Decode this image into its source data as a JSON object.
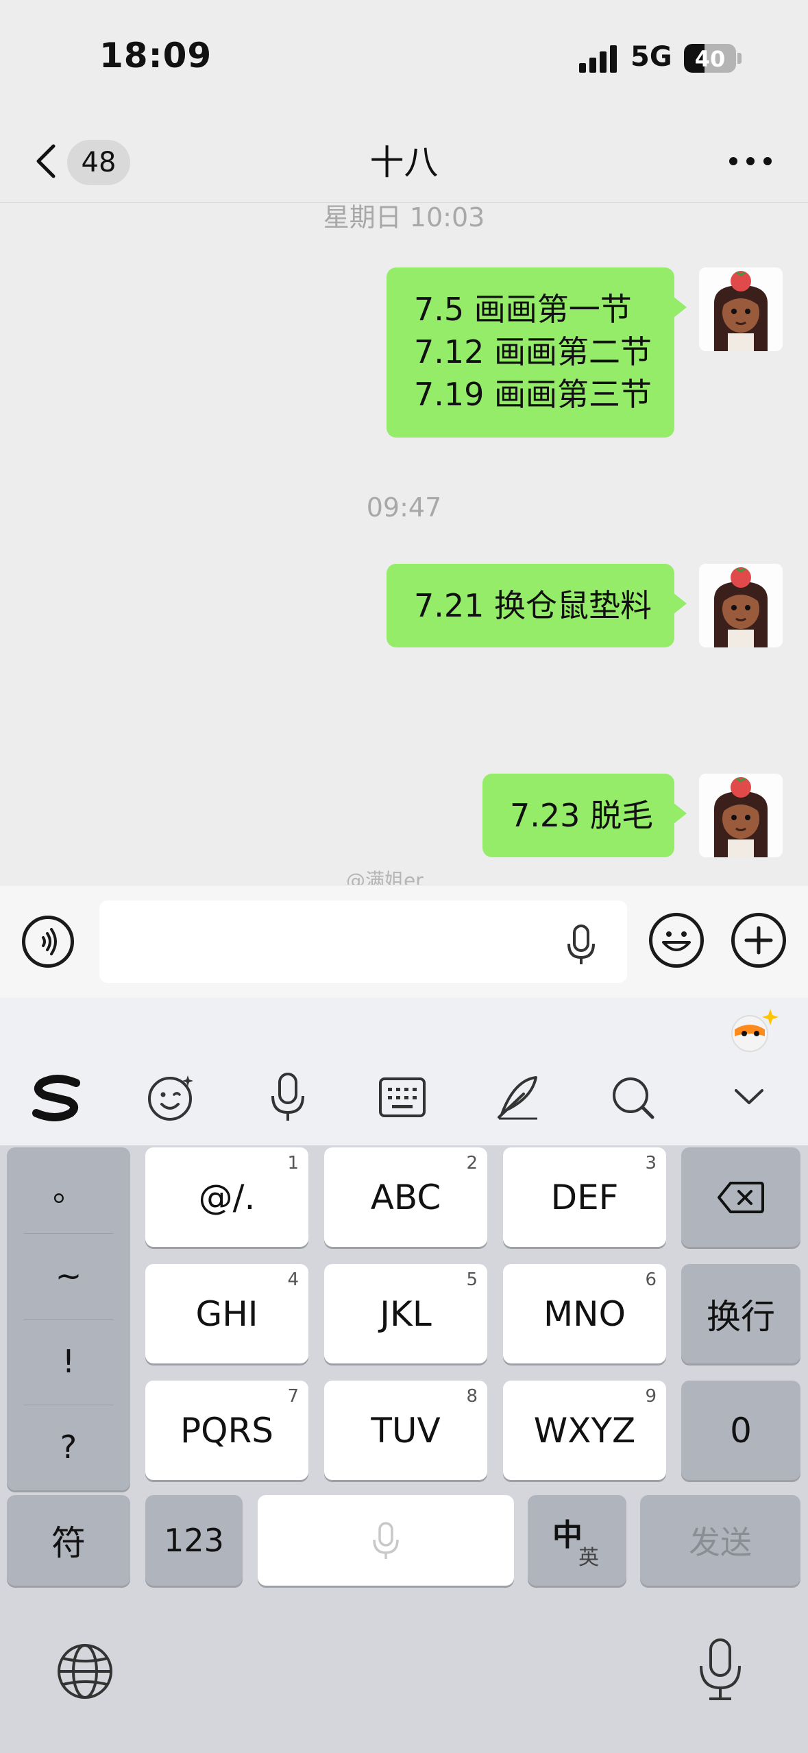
{
  "status": {
    "time": "18:09",
    "network": "5G",
    "battery": "40",
    "battery_level": 0.4
  },
  "nav": {
    "unread_count": "48",
    "title": "十八"
  },
  "chat": {
    "time_1": "星期日 10:03",
    "msg_1": [
      "7.5 画画第一节",
      "7.12 画画第二节",
      "7.19 画画第三节"
    ],
    "time_2": "09:47",
    "msg_2": "7.21 换仓鼠垫料",
    "msg_3": "7.23 脱毛"
  },
  "watermark": "@满姐er",
  "input": {
    "value": ""
  },
  "keyboard": {
    "symbols": [
      "。",
      "~",
      "!",
      "?"
    ],
    "keys": [
      {
        "label": "@/.",
        "num": "1"
      },
      {
        "label": "ABC",
        "num": "2"
      },
      {
        "label": "DEF",
        "num": "3"
      },
      {
        "label": "GHI",
        "num": "4"
      },
      {
        "label": "JKL",
        "num": "5"
      },
      {
        "label": "MNO",
        "num": "6"
      },
      {
        "label": "PQRS",
        "num": "7"
      },
      {
        "label": "TUV",
        "num": "8"
      },
      {
        "label": "WXYZ",
        "num": "9"
      }
    ],
    "return_label": "换行",
    "zero_label": "0",
    "symbol_key": "符",
    "num_key": "123",
    "lang_zh": "中",
    "lang_en": "英",
    "send_label": "发送"
  },
  "icons": {
    "back": "chevron-left-icon",
    "more": "more-icon",
    "voice": "voice-icon",
    "emoji": "emoji-icon",
    "plus": "plus-icon",
    "mic": "mic-icon",
    "globe": "globe-icon"
  },
  "colors": {
    "bubble": "#95ec69",
    "background": "#ededed",
    "keyboard": "#d4d6dc"
  }
}
